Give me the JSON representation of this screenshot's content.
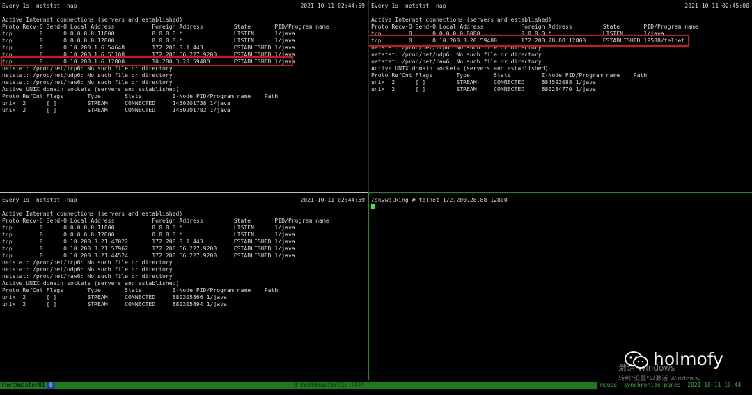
{
  "panes": {
    "top_left": {
      "header": "Every 1s: netstat -nap",
      "clock": "2021-10-11 02:44:59",
      "lines": [
        "Active Internet connections (servers and established)",
        "Proto Recv-Q Send-Q Local Address           Foreign Address         State       PID/Program name",
        "tcp        0      0 0.0.0.0:11800           0.0.0.0:*               LISTEN      1/java",
        "tcp        0      0 0.0.0.0:12800           0.0.0.0:*               LISTEN      1/java",
        "tcp        0      0 10.200.1.6:54648        172.200.0.1:443         ESTABLISHED 1/java",
        "tcp        0      0 10.200.1.6:51108        172.200.66.227:9200     ESTABLISHED 1/java",
        "tcp        0      0 10.200.1.6:12800        10.200.3.20:59480       ESTABLISHED 1/java",
        "netstat: /proc/net/tcp6: No such file or directory",
        "netstat: /proc/net/udp6: No such file or directory",
        "netstat: /proc/net/raw6: No such file or directory",
        "Active UNIX domain sockets (servers and established)",
        "Proto RefCnt Flags       Type       State         I-Node PID/Program name    Path",
        "unix  2      [ ]         STREAM     CONNECTED     1450201738 1/java",
        "unix  2      [ ]         STREAM     CONNECTED     1450201782 1/java"
      ]
    },
    "top_right": {
      "header": "Every 1s: netstat -nap",
      "clock": "2021-10-11 02:45:00",
      "lines": [
        "Active Internet connections (servers and established)",
        "Proto Recv-Q Send-Q Local Address           Foreign Address         State       PID/Program name",
        "tcp        0      0 0.0.0.0:8080            0.0.0.0:*               LISTEN      1/java",
        "tcp        0      0 10.200.3.20:59480       172.200.28.88:12800     ESTABLISHED 19588/telnet",
        "netstat: /proc/net/tcp6: No such file or directory",
        "netstat: /proc/net/udp6: No such file or directory",
        "netstat: /proc/net/raw6: No such file or directory",
        "Active UNIX domain sockets (servers and established)",
        "Proto RefCnt Flags       Type       State         I-Node PID/Program name    Path",
        "unix  2      [ ]         STREAM     CONNECTED     884593088 1/java",
        "unix  2      [ ]         STREAM     CONNECTED     880284770 1/java"
      ]
    },
    "bottom_left": {
      "header": "Every 1s: netstat -nap",
      "clock": "2021-10-11 02:44:59",
      "lines": [
        "Active Internet connections (servers and established)",
        "Proto Recv-Q Send-Q Local Address           Foreign Address         State       PID/Program name",
        "tcp        0      0 0.0.0.0:11800           0.0.0.0:*               LISTEN      1/java",
        "tcp        0      0 0.0.0.0:12800           0.0.0.0:*               LISTEN      1/java",
        "tcp        0      0 10.200.3.21:47022       172.200.0.1:443         ESTABLISHED 1/java",
        "tcp        0      0 10.200.3.21:57962       172.200.66.227:9200     ESTABLISHED 1/java",
        "tcp        0      0 10.200.3.21:44524       172.200.66.227:9200     ESTABLISHED 1/java",
        "netstat: /proc/net/tcp6: No such file or directory",
        "netstat: /proc/net/udp6: No such file or directory",
        "netstat: /proc/net/raw6: No such file or directory",
        "Active UNIX domain sockets (servers and established)",
        "Proto RefCnt Flags       Type       State         I-Node PID/Program name    Path",
        "unix  2      [ ]         STREAM     CONNECTED     880305866 1/java",
        "unix  2      [ ]         STREAM     CONNECTED     880305894 1/java"
      ]
    },
    "bottom_right": {
      "prompt_line": "/skywalking # telnet 172.200.28.88 12800"
    }
  },
  "statusbar": {
    "session": "root@master01",
    "window": "0",
    "center": "0:root@master01:~[4]*",
    "right": "mouse  synchronize-panes  2021-10-11 10:44"
  },
  "watermark": {
    "activate_title": "激活 Windows",
    "activate_sub": "转到\"设置\"以激活 Windows。",
    "brand": "holmofy"
  },
  "colors": {
    "highlight_box": "#d4141a",
    "cursor": "#2ff22f",
    "status_bar": "#1c7c1c"
  }
}
